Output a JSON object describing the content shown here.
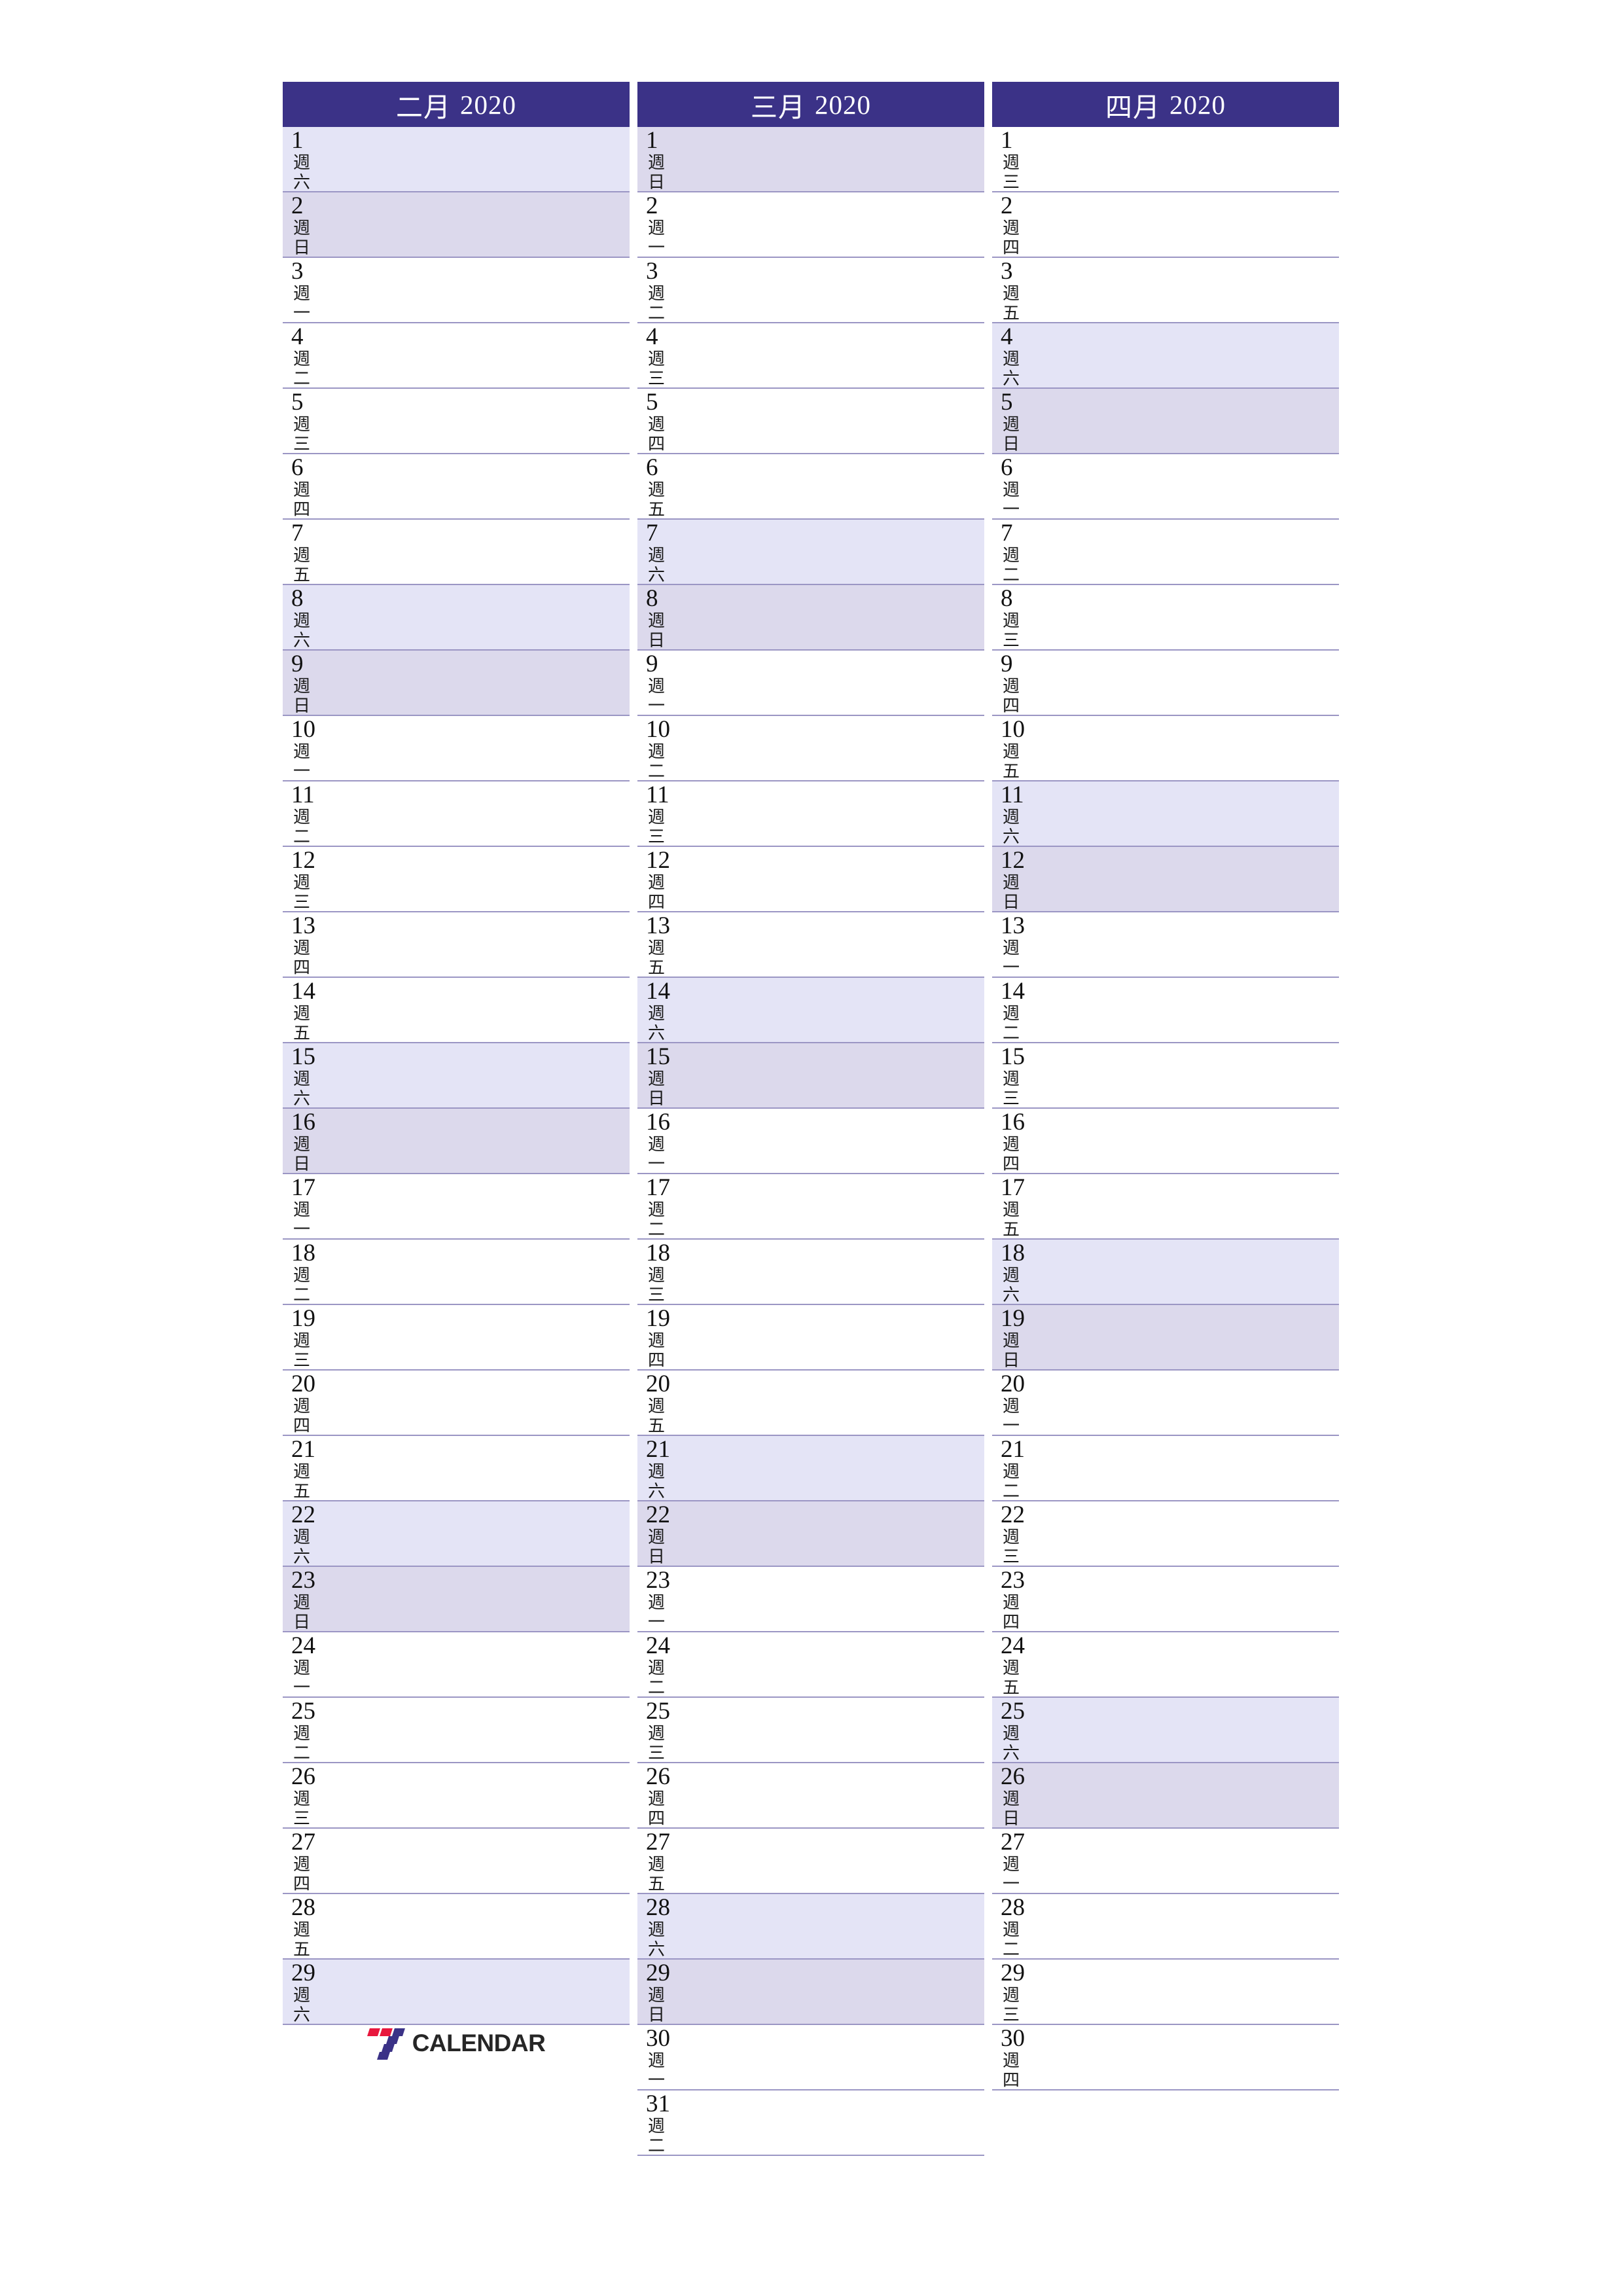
{
  "page": {
    "background": "#ffffff",
    "header_color": "#3b3287",
    "saturday_color": "#e4e4f6",
    "sunday_color": "#dcd9ec",
    "divider_color": "#9b96c4"
  },
  "logo": {
    "text": "CALENDAR",
    "mark_red": "#e8173d",
    "mark_blue": "#3b3287"
  },
  "months": [
    {
      "name": "二月",
      "year": "2020",
      "header": "二月 2020",
      "days": [
        {
          "num": "1",
          "weekday": "週六",
          "wd1": "週",
          "wd2": "六",
          "type": "sat"
        },
        {
          "num": "2",
          "weekday": "週日",
          "wd1": "週",
          "wd2": "日",
          "type": "sun"
        },
        {
          "num": "3",
          "weekday": "週一",
          "wd1": "週",
          "wd2": "一",
          "type": "weekday"
        },
        {
          "num": "4",
          "weekday": "週二",
          "wd1": "週",
          "wd2": "二",
          "type": "weekday"
        },
        {
          "num": "5",
          "weekday": "週三",
          "wd1": "週",
          "wd2": "三",
          "type": "weekday"
        },
        {
          "num": "6",
          "weekday": "週四",
          "wd1": "週",
          "wd2": "四",
          "type": "weekday"
        },
        {
          "num": "7",
          "weekday": "週五",
          "wd1": "週",
          "wd2": "五",
          "type": "weekday"
        },
        {
          "num": "8",
          "weekday": "週六",
          "wd1": "週",
          "wd2": "六",
          "type": "sat"
        },
        {
          "num": "9",
          "weekday": "週日",
          "wd1": "週",
          "wd2": "日",
          "type": "sun"
        },
        {
          "num": "10",
          "weekday": "週一",
          "wd1": "週",
          "wd2": "一",
          "type": "weekday"
        },
        {
          "num": "11",
          "weekday": "週二",
          "wd1": "週",
          "wd2": "二",
          "type": "weekday"
        },
        {
          "num": "12",
          "weekday": "週三",
          "wd1": "週",
          "wd2": "三",
          "type": "weekday"
        },
        {
          "num": "13",
          "weekday": "週四",
          "wd1": "週",
          "wd2": "四",
          "type": "weekday"
        },
        {
          "num": "14",
          "weekday": "週五",
          "wd1": "週",
          "wd2": "五",
          "type": "weekday"
        },
        {
          "num": "15",
          "weekday": "週六",
          "wd1": "週",
          "wd2": "六",
          "type": "sat"
        },
        {
          "num": "16",
          "weekday": "週日",
          "wd1": "週",
          "wd2": "日",
          "type": "sun"
        },
        {
          "num": "17",
          "weekday": "週一",
          "wd1": "週",
          "wd2": "一",
          "type": "weekday"
        },
        {
          "num": "18",
          "weekday": "週二",
          "wd1": "週",
          "wd2": "二",
          "type": "weekday"
        },
        {
          "num": "19",
          "weekday": "週三",
          "wd1": "週",
          "wd2": "三",
          "type": "weekday"
        },
        {
          "num": "20",
          "weekday": "週四",
          "wd1": "週",
          "wd2": "四",
          "type": "weekday"
        },
        {
          "num": "21",
          "weekday": "週五",
          "wd1": "週",
          "wd2": "五",
          "type": "weekday"
        },
        {
          "num": "22",
          "weekday": "週六",
          "wd1": "週",
          "wd2": "六",
          "type": "sat"
        },
        {
          "num": "23",
          "weekday": "週日",
          "wd1": "週",
          "wd2": "日",
          "type": "sun"
        },
        {
          "num": "24",
          "weekday": "週一",
          "wd1": "週",
          "wd2": "一",
          "type": "weekday"
        },
        {
          "num": "25",
          "weekday": "週二",
          "wd1": "週",
          "wd2": "二",
          "type": "weekday"
        },
        {
          "num": "26",
          "weekday": "週三",
          "wd1": "週",
          "wd2": "三",
          "type": "weekday"
        },
        {
          "num": "27",
          "weekday": "週四",
          "wd1": "週",
          "wd2": "四",
          "type": "weekday"
        },
        {
          "num": "28",
          "weekday": "週五",
          "wd1": "週",
          "wd2": "五",
          "type": "weekday"
        },
        {
          "num": "29",
          "weekday": "週六",
          "wd1": "週",
          "wd2": "六",
          "type": "sat"
        }
      ]
    },
    {
      "name": "三月",
      "year": "2020",
      "header": "三月 2020",
      "days": [
        {
          "num": "1",
          "weekday": "週日",
          "wd1": "週",
          "wd2": "日",
          "type": "sun"
        },
        {
          "num": "2",
          "weekday": "週一",
          "wd1": "週",
          "wd2": "一",
          "type": "weekday"
        },
        {
          "num": "3",
          "weekday": "週二",
          "wd1": "週",
          "wd2": "二",
          "type": "weekday"
        },
        {
          "num": "4",
          "weekday": "週三",
          "wd1": "週",
          "wd2": "三",
          "type": "weekday"
        },
        {
          "num": "5",
          "weekday": "週四",
          "wd1": "週",
          "wd2": "四",
          "type": "weekday"
        },
        {
          "num": "6",
          "weekday": "週五",
          "wd1": "週",
          "wd2": "五",
          "type": "weekday"
        },
        {
          "num": "7",
          "weekday": "週六",
          "wd1": "週",
          "wd2": "六",
          "type": "sat"
        },
        {
          "num": "8",
          "weekday": "週日",
          "wd1": "週",
          "wd2": "日",
          "type": "sun"
        },
        {
          "num": "9",
          "weekday": "週一",
          "wd1": "週",
          "wd2": "一",
          "type": "weekday"
        },
        {
          "num": "10",
          "weekday": "週二",
          "wd1": "週",
          "wd2": "二",
          "type": "weekday"
        },
        {
          "num": "11",
          "weekday": "週三",
          "wd1": "週",
          "wd2": "三",
          "type": "weekday"
        },
        {
          "num": "12",
          "weekday": "週四",
          "wd1": "週",
          "wd2": "四",
          "type": "weekday"
        },
        {
          "num": "13",
          "weekday": "週五",
          "wd1": "週",
          "wd2": "五",
          "type": "weekday"
        },
        {
          "num": "14",
          "weekday": "週六",
          "wd1": "週",
          "wd2": "六",
          "type": "sat"
        },
        {
          "num": "15",
          "weekday": "週日",
          "wd1": "週",
          "wd2": "日",
          "type": "sun"
        },
        {
          "num": "16",
          "weekday": "週一",
          "wd1": "週",
          "wd2": "一",
          "type": "weekday"
        },
        {
          "num": "17",
          "weekday": "週二",
          "wd1": "週",
          "wd2": "二",
          "type": "weekday"
        },
        {
          "num": "18",
          "weekday": "週三",
          "wd1": "週",
          "wd2": "三",
          "type": "weekday"
        },
        {
          "num": "19",
          "weekday": "週四",
          "wd1": "週",
          "wd2": "四",
          "type": "weekday"
        },
        {
          "num": "20",
          "weekday": "週五",
          "wd1": "週",
          "wd2": "五",
          "type": "weekday"
        },
        {
          "num": "21",
          "weekday": "週六",
          "wd1": "週",
          "wd2": "六",
          "type": "sat"
        },
        {
          "num": "22",
          "weekday": "週日",
          "wd1": "週",
          "wd2": "日",
          "type": "sun"
        },
        {
          "num": "23",
          "weekday": "週一",
          "wd1": "週",
          "wd2": "一",
          "type": "weekday"
        },
        {
          "num": "24",
          "weekday": "週二",
          "wd1": "週",
          "wd2": "二",
          "type": "weekday"
        },
        {
          "num": "25",
          "weekday": "週三",
          "wd1": "週",
          "wd2": "三",
          "type": "weekday"
        },
        {
          "num": "26",
          "weekday": "週四",
          "wd1": "週",
          "wd2": "四",
          "type": "weekday"
        },
        {
          "num": "27",
          "weekday": "週五",
          "wd1": "週",
          "wd2": "五",
          "type": "weekday"
        },
        {
          "num": "28",
          "weekday": "週六",
          "wd1": "週",
          "wd2": "六",
          "type": "sat"
        },
        {
          "num": "29",
          "weekday": "週日",
          "wd1": "週",
          "wd2": "日",
          "type": "sun"
        },
        {
          "num": "30",
          "weekday": "週一",
          "wd1": "週",
          "wd2": "一",
          "type": "weekday"
        },
        {
          "num": "31",
          "weekday": "週二",
          "wd1": "週",
          "wd2": "二",
          "type": "weekday"
        }
      ]
    },
    {
      "name": "四月",
      "year": "2020",
      "header": "四月 2020",
      "days": [
        {
          "num": "1",
          "weekday": "週三",
          "wd1": "週",
          "wd2": "三",
          "type": "weekday"
        },
        {
          "num": "2",
          "weekday": "週四",
          "wd1": "週",
          "wd2": "四",
          "type": "weekday"
        },
        {
          "num": "3",
          "weekday": "週五",
          "wd1": "週",
          "wd2": "五",
          "type": "weekday"
        },
        {
          "num": "4",
          "weekday": "週六",
          "wd1": "週",
          "wd2": "六",
          "type": "sat"
        },
        {
          "num": "5",
          "weekday": "週日",
          "wd1": "週",
          "wd2": "日",
          "type": "sun"
        },
        {
          "num": "6",
          "weekday": "週一",
          "wd1": "週",
          "wd2": "一",
          "type": "weekday"
        },
        {
          "num": "7",
          "weekday": "週二",
          "wd1": "週",
          "wd2": "二",
          "type": "weekday"
        },
        {
          "num": "8",
          "weekday": "週三",
          "wd1": "週",
          "wd2": "三",
          "type": "weekday"
        },
        {
          "num": "9",
          "weekday": "週四",
          "wd1": "週",
          "wd2": "四",
          "type": "weekday"
        },
        {
          "num": "10",
          "weekday": "週五",
          "wd1": "週",
          "wd2": "五",
          "type": "weekday"
        },
        {
          "num": "11",
          "weekday": "週六",
          "wd1": "週",
          "wd2": "六",
          "type": "sat"
        },
        {
          "num": "12",
          "weekday": "週日",
          "wd1": "週",
          "wd2": "日",
          "type": "sun"
        },
        {
          "num": "13",
          "weekday": "週一",
          "wd1": "週",
          "wd2": "一",
          "type": "weekday"
        },
        {
          "num": "14",
          "weekday": "週二",
          "wd1": "週",
          "wd2": "二",
          "type": "weekday"
        },
        {
          "num": "15",
          "weekday": "週三",
          "wd1": "週",
          "wd2": "三",
          "type": "weekday"
        },
        {
          "num": "16",
          "weekday": "週四",
          "wd1": "週",
          "wd2": "四",
          "type": "weekday"
        },
        {
          "num": "17",
          "weekday": "週五",
          "wd1": "週",
          "wd2": "五",
          "type": "weekday"
        },
        {
          "num": "18",
          "weekday": "週六",
          "wd1": "週",
          "wd2": "六",
          "type": "sat"
        },
        {
          "num": "19",
          "weekday": "週日",
          "wd1": "週",
          "wd2": "日",
          "type": "sun"
        },
        {
          "num": "20",
          "weekday": "週一",
          "wd1": "週",
          "wd2": "一",
          "type": "weekday"
        },
        {
          "num": "21",
          "weekday": "週二",
          "wd1": "週",
          "wd2": "二",
          "type": "weekday"
        },
        {
          "num": "22",
          "weekday": "週三",
          "wd1": "週",
          "wd2": "三",
          "type": "weekday"
        },
        {
          "num": "23",
          "weekday": "週四",
          "wd1": "週",
          "wd2": "四",
          "type": "weekday"
        },
        {
          "num": "24",
          "weekday": "週五",
          "wd1": "週",
          "wd2": "五",
          "type": "weekday"
        },
        {
          "num": "25",
          "weekday": "週六",
          "wd1": "週",
          "wd2": "六",
          "type": "sat"
        },
        {
          "num": "26",
          "weekday": "週日",
          "wd1": "週",
          "wd2": "日",
          "type": "sun"
        },
        {
          "num": "27",
          "weekday": "週一",
          "wd1": "週",
          "wd2": "一",
          "type": "weekday"
        },
        {
          "num": "28",
          "weekday": "週二",
          "wd1": "週",
          "wd2": "二",
          "type": "weekday"
        },
        {
          "num": "29",
          "weekday": "週三",
          "wd1": "週",
          "wd2": "三",
          "type": "weekday"
        },
        {
          "num": "30",
          "weekday": "週四",
          "wd1": "週",
          "wd2": "四",
          "type": "weekday"
        }
      ]
    }
  ]
}
